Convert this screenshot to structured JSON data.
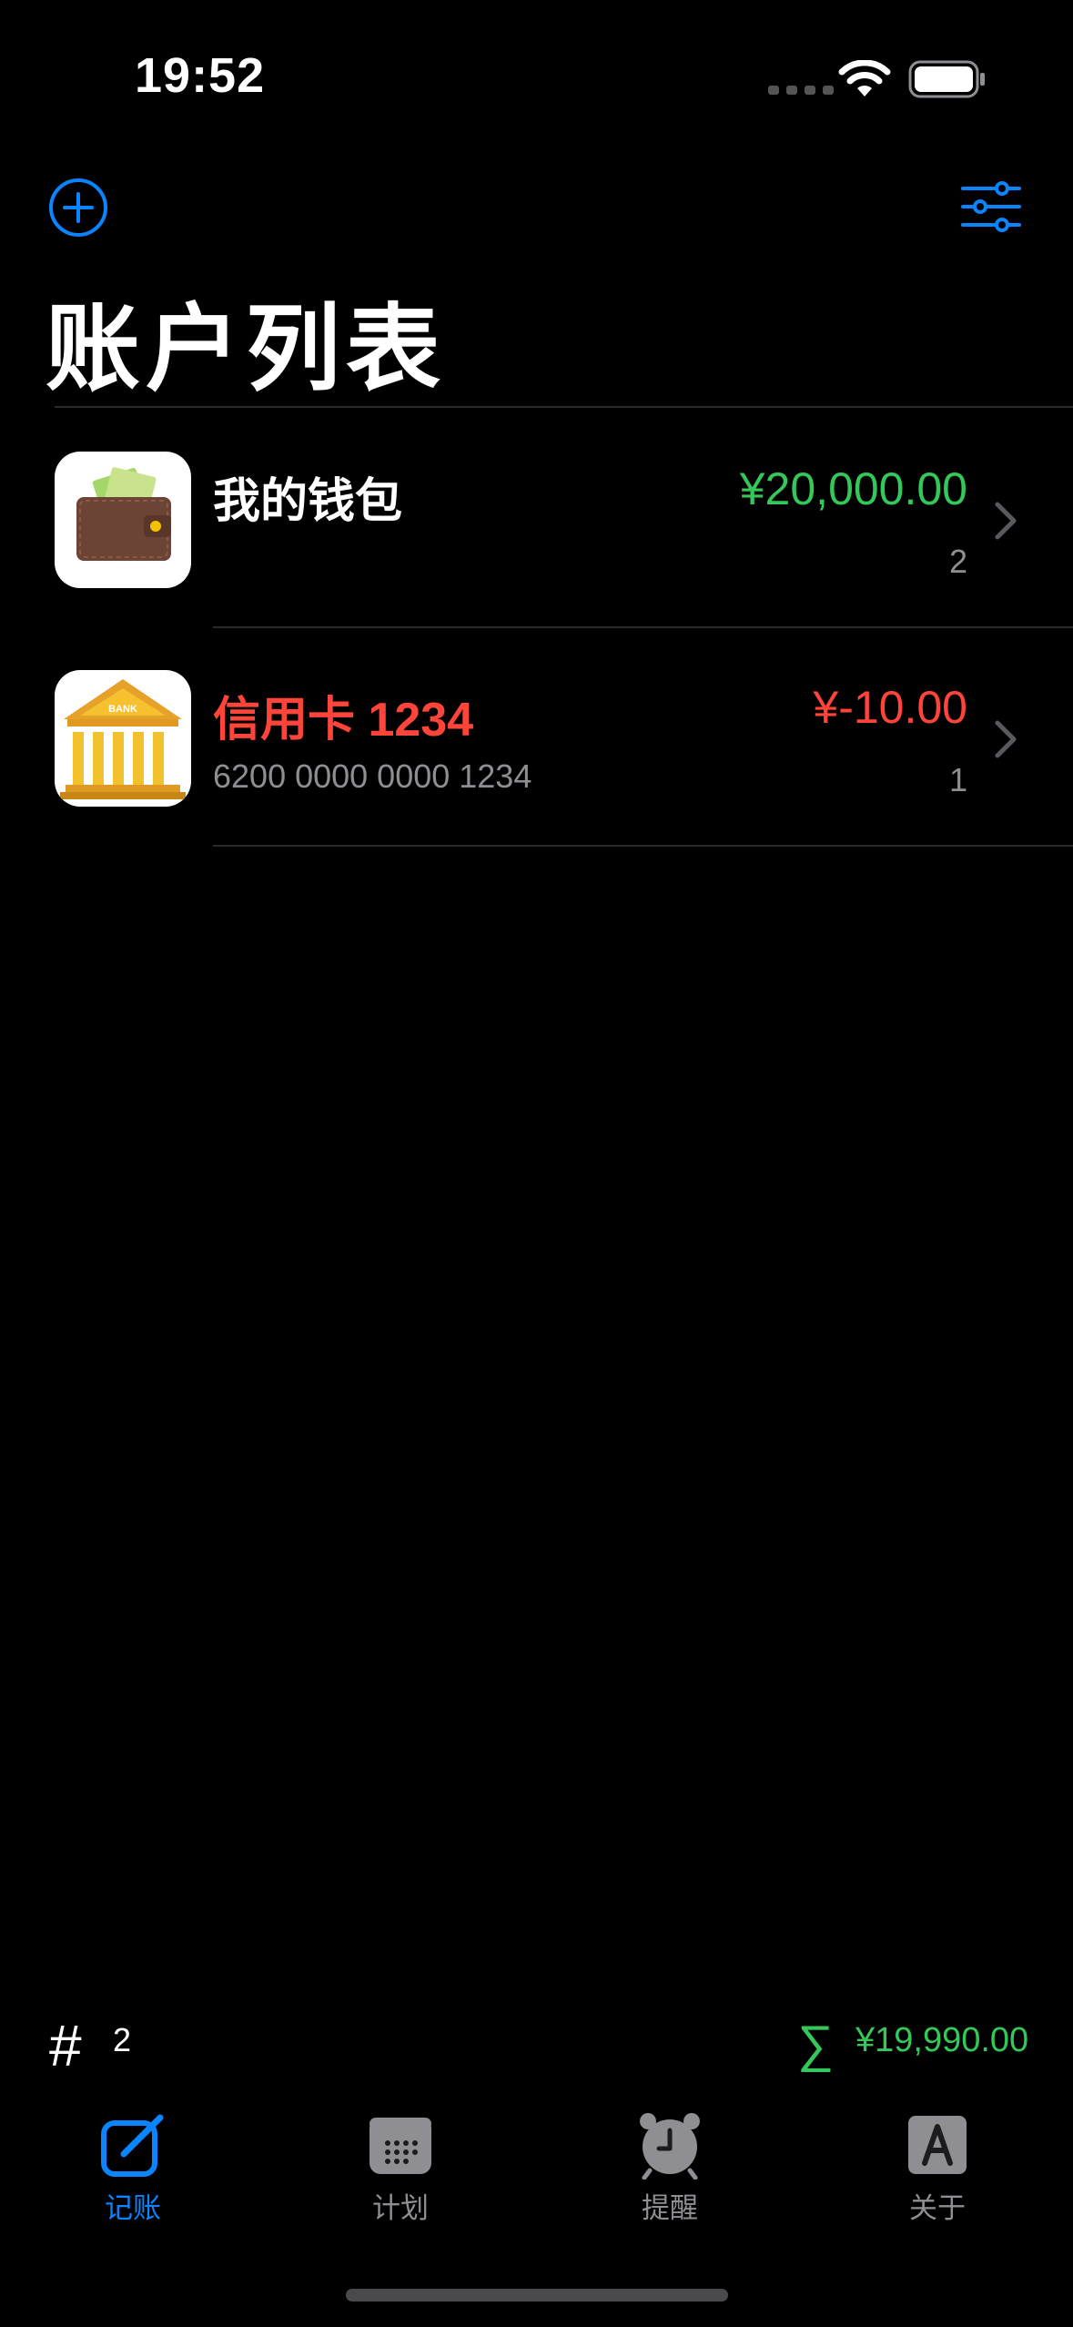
{
  "status_bar": {
    "time": "19:52"
  },
  "header": {
    "title": "账户列表"
  },
  "accounts": [
    {
      "name": "我的钱包",
      "subtitle": "",
      "amount": "¥20,000.00",
      "count": "2",
      "name_color": "#ffffff",
      "amount_color": "#34c759",
      "icon": "wallet-icon"
    },
    {
      "name": "信用卡 1234",
      "subtitle": "6200 0000 0000 1234",
      "amount": "¥-10.00",
      "count": "1",
      "name_color": "#ff453a",
      "amount_color": "#ff453a",
      "icon": "bank-icon",
      "icon_text": "BANK"
    }
  ],
  "summary": {
    "count_symbol": "#",
    "count": "2",
    "sum_symbol": "∑",
    "total": "¥19,990.00"
  },
  "tabs": [
    {
      "label": "记账",
      "icon": "compose-icon",
      "active": true
    },
    {
      "label": "计划",
      "icon": "calendar-icon",
      "active": false
    },
    {
      "label": "提醒",
      "icon": "alarm-clock-icon",
      "active": false
    },
    {
      "label": "关于",
      "icon": "letter-a-icon",
      "active": false
    }
  ],
  "colors": {
    "accent": "#0a84ff",
    "positive": "#34c759",
    "negative": "#ff453a",
    "background": "#000000"
  }
}
